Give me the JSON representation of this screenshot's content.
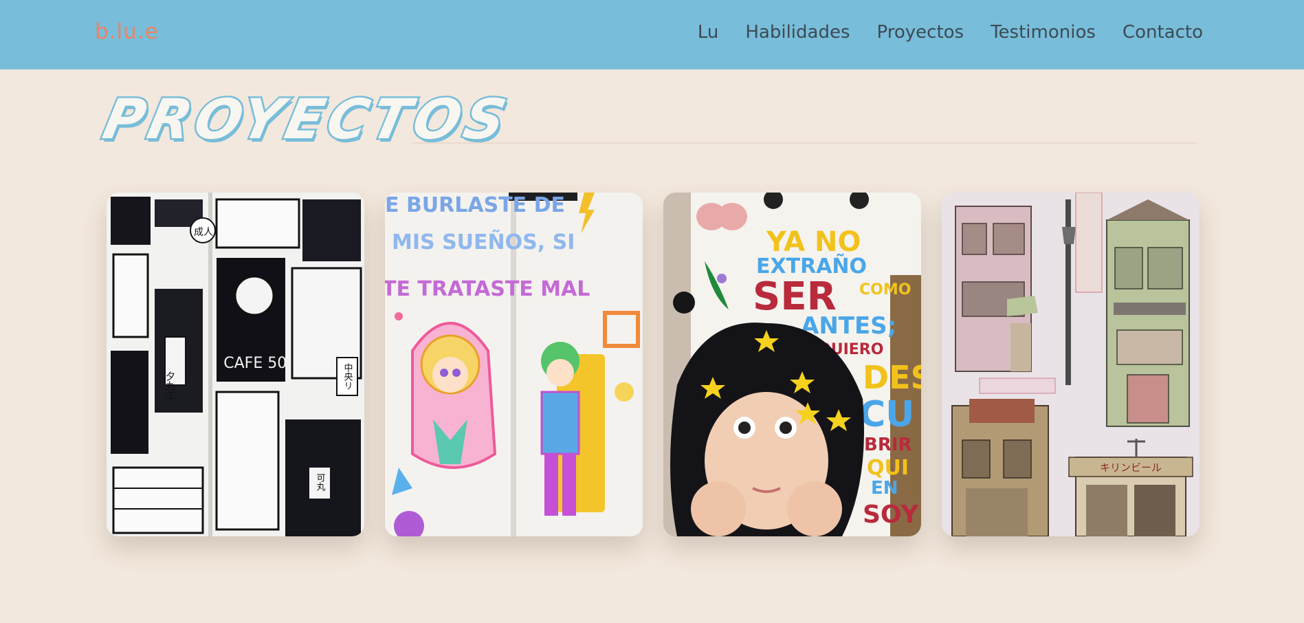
{
  "brand": {
    "logo": "b.lu.e"
  },
  "nav": {
    "items": [
      {
        "label": "Lu"
      },
      {
        "label": "Habilidades"
      },
      {
        "label": "Proyectos"
      },
      {
        "label": "Testimonios"
      },
      {
        "label": "Contacto"
      }
    ]
  },
  "projects": {
    "title": "PROYECTOS",
    "cards": [
      {
        "kind": "black-and-white manga street sketchbook spread",
        "texts": [
          "成人",
          "夕丸工",
          "CAFE 50's",
          "中央リ",
          "可丸"
        ]
      },
      {
        "kind": "colorful marker sketchbook spread",
        "texts": [
          "E BURLASTE DE",
          "MIS SUEÑOS, SI",
          "TE TRATASTE MAL"
        ]
      },
      {
        "kind": "lettering illustration with portrait",
        "texts": [
          "YA NO",
          "EXTRAÑO",
          "SER",
          "COMO",
          "ANTES;",
          "QUIERO",
          "DES",
          "CU",
          "BRIR",
          "QUI",
          "EN",
          "SOY"
        ]
      },
      {
        "kind": "watercolor storefront buildings",
        "texts": [
          "キリンビール"
        ]
      }
    ]
  },
  "colors": {
    "navbar": "#78bdd9",
    "background": "#f3e8dd",
    "logo": "#ee8266",
    "nav_text": "#3c4a55",
    "title_outline": "#78bdd9"
  }
}
